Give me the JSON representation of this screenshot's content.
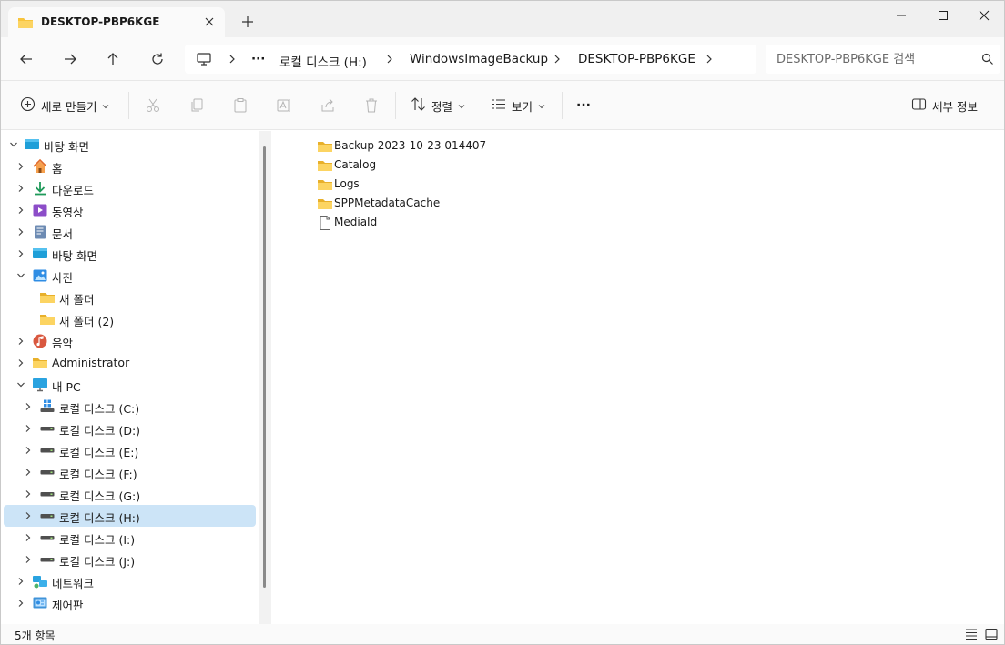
{
  "window": {
    "tab_title": "DESKTOP-PBP6KGE",
    "tab_icon": "folder-icon",
    "new_tab_icon": "plus-icon",
    "controls": [
      "minimize-icon",
      "maximize-icon",
      "close-icon"
    ]
  },
  "address": {
    "segments": [
      "로컬 디스크 (H:)",
      "WindowsImageBackup",
      "DESKTOP-PBP6KGE"
    ],
    "overflow": "···",
    "search_placeholder": "DESKTOP-PBP6KGE 검색"
  },
  "toolbar": {
    "new_label": "새로 만들기",
    "sort_label": "정렬",
    "view_label": "보기",
    "more_label": "···",
    "details_label": "세부 정보"
  },
  "nav": {
    "items": [
      {
        "label": "바탕 화면",
        "icon": "desktop-icon",
        "expander": "open"
      },
      {
        "label": "홈",
        "icon": "home-icon",
        "expander": "closed"
      },
      {
        "label": "다운로드",
        "icon": "download-icon",
        "expander": "closed"
      },
      {
        "label": "동영상",
        "icon": "video-icon",
        "expander": "closed"
      },
      {
        "label": "문서",
        "icon": "document-icon",
        "expander": "closed"
      },
      {
        "label": "바탕 화면",
        "icon": "desktop-icon",
        "expander": "closed"
      },
      {
        "label": "사진",
        "icon": "picture-icon",
        "expander": "open"
      },
      {
        "label": "새 폴더",
        "icon": "folder-icon",
        "expander": "none"
      },
      {
        "label": "새 폴더 (2)",
        "icon": "folder-icon",
        "expander": "none"
      },
      {
        "label": "음악",
        "icon": "music-icon",
        "expander": "closed"
      },
      {
        "label": "Administrator",
        "icon": "folder-icon",
        "expander": "closed"
      },
      {
        "label": "내 PC",
        "icon": "pc-icon",
        "expander": "open"
      },
      {
        "label": "로컬 디스크 (C:)",
        "icon": "windows-drive-icon",
        "expander": "closed"
      },
      {
        "label": "로컬 디스크 (D:)",
        "icon": "drive-icon",
        "expander": "closed"
      },
      {
        "label": "로컬 디스크 (E:)",
        "icon": "drive-icon",
        "expander": "closed"
      },
      {
        "label": "로컬 디스크 (F:)",
        "icon": "drive-icon",
        "expander": "closed"
      },
      {
        "label": "로컬 디스크 (G:)",
        "icon": "drive-icon",
        "expander": "closed"
      },
      {
        "label": "로컬 디스크 (H:)",
        "icon": "drive-icon",
        "expander": "closed",
        "selected": true
      },
      {
        "label": "로컬 디스크 (I:)",
        "icon": "drive-icon",
        "expander": "closed"
      },
      {
        "label": "로컬 디스크 (J:)",
        "icon": "drive-icon",
        "expander": "closed"
      },
      {
        "label": "네트워크",
        "icon": "network-icon",
        "expander": "closed"
      },
      {
        "label": "제어판",
        "icon": "control-panel-icon",
        "expander": "closed"
      }
    ]
  },
  "files": [
    {
      "name": "Backup 2023-10-23 014407",
      "icon": "folder-icon"
    },
    {
      "name": "Catalog",
      "icon": "folder-icon"
    },
    {
      "name": "Logs",
      "icon": "folder-icon"
    },
    {
      "name": "SPPMetadataCache",
      "icon": "folder-icon"
    },
    {
      "name": "MediaId",
      "icon": "file-icon"
    }
  ],
  "status": {
    "item_count": "5개 항목"
  },
  "colors": {
    "selection": "#cce4f7",
    "folder": "#f8c43c",
    "accent": "#0067c0"
  }
}
